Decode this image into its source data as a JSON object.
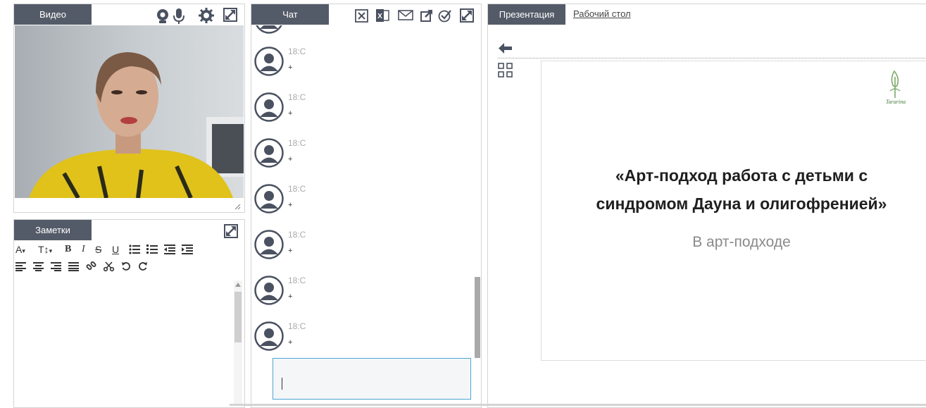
{
  "video": {
    "tab_label": "Видео"
  },
  "notes": {
    "tab_label": "Заметки"
  },
  "chat": {
    "tab_label": "Чат",
    "messages": [
      {
        "time": "18:C",
        "text": "+"
      },
      {
        "time": "18:C",
        "text": "+"
      },
      {
        "time": "18:C",
        "text": "+"
      },
      {
        "time": "18:C",
        "text": "+"
      },
      {
        "time": "18:C",
        "text": "+"
      },
      {
        "time": "18:C",
        "text": "+"
      },
      {
        "time": "18:C",
        "text": "+"
      }
    ],
    "input_value": ""
  },
  "presentation": {
    "tab_label": "Презентация",
    "desktop_link": "Рабочий стол",
    "slide": {
      "title_line1": "«Арт-подход работа с детьми с",
      "title_line2": "синдромом Дауна и олигофренией»",
      "subtitle": "В арт-подходе",
      "logo_text": "Tararina"
    }
  },
  "colors": {
    "tab_bg": "#545b68",
    "icon": "#4a5160",
    "input_border": "#4aa6d6"
  }
}
